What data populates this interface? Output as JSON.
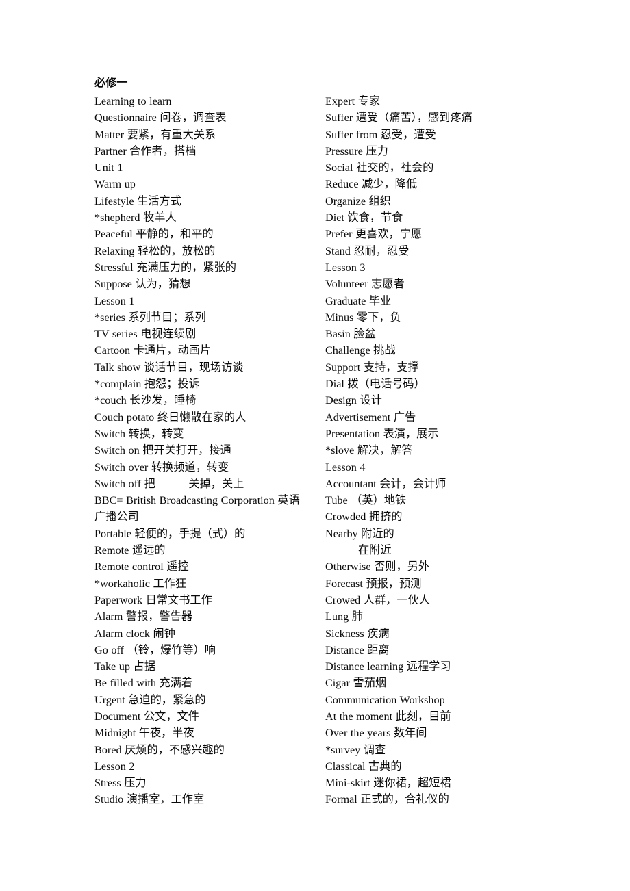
{
  "document": {
    "heading": "必修一"
  },
  "columns": {
    "left": [
      {
        "text": "Learning to learn"
      },
      {
        "text": "Questionnaire  问卷，调查表"
      },
      {
        "text": "Matter  要紧，有重大关系"
      },
      {
        "text": "Partner  合作者，搭档"
      },
      {
        "text": "Unit 1"
      },
      {
        "text": "Warm up"
      },
      {
        "text": "Lifestyle  生活方式"
      },
      {
        "text": "*shepherd  牧羊人"
      },
      {
        "text": "Peaceful  平静的，和平的"
      },
      {
        "text": "Relaxing  轻松的，放松的"
      },
      {
        "text": "Stressful  充满压力的，紧张的"
      },
      {
        "text": "Suppose  认为，猜想"
      },
      {
        "text": "Lesson 1"
      },
      {
        "text": "*series  系列节目；系列"
      },
      {
        "text": "TV series  电视连续剧"
      },
      {
        "text": "Cartoon  卡通片，动画片"
      },
      {
        "text": "Talk show  谈话节目，现场访谈"
      },
      {
        "text": "*complain  抱怨；投诉"
      },
      {
        "text": "*couch  长沙发，睡椅"
      },
      {
        "text": "Couch potato  终日懒散在家的人"
      },
      {
        "text": "Switch  转换，转变"
      },
      {
        "text": "Switch on  把开关打开，接通"
      },
      {
        "text": "Switch over  转换频道，转变"
      },
      {
        "text": "Switch off 把　　　关掉，关上"
      },
      {
        "text": "BBC= British Broadcasting Corporation  英语广播公司",
        "wrap": true
      },
      {
        "text": "Portable  轻便的，手提（式）的"
      },
      {
        "text": "Remote  遥远的"
      },
      {
        "text": "Remote control  遥控"
      },
      {
        "text": "*workaholic  工作狂"
      },
      {
        "text": "Paperwork  日常文书工作"
      },
      {
        "text": "Alarm  警报，警告器"
      },
      {
        "text": "Alarm clock  闹钟"
      },
      {
        "text": "Go off  （铃，爆竹等）响"
      },
      {
        "text": "Take up  占据"
      },
      {
        "text": "Be filled with  充满着"
      },
      {
        "text": "Urgent  急迫的，紧急的"
      },
      {
        "text": "Document  公文，文件"
      },
      {
        "text": "Midnight  午夜，半夜"
      },
      {
        "text": "Bored  厌烦的，不感兴趣的"
      },
      {
        "text": "Lesson 2"
      },
      {
        "text": "Stress  压力"
      },
      {
        "text": "Studio  演播室，工作室"
      }
    ],
    "right": [
      {
        "text": "Expert  专家"
      },
      {
        "text": "Suffer  遭受（痛苦），感到疼痛"
      },
      {
        "text": "Suffer from  忍受，遭受"
      },
      {
        "text": "Pressure  压力"
      },
      {
        "text": "Social  社交的，社会的"
      },
      {
        "text": "Reduce  减少，降低"
      },
      {
        "text": "Organize  组织"
      },
      {
        "text": "Diet  饮食，节食"
      },
      {
        "text": "Prefer  更喜欢，宁愿"
      },
      {
        "text": "Stand  忍耐，忍受"
      },
      {
        "text": "Lesson 3"
      },
      {
        "text": "Volunteer  志愿者"
      },
      {
        "text": "Graduate  毕业"
      },
      {
        "text": "Minus  零下，负"
      },
      {
        "text": "Basin  脸盆"
      },
      {
        "text": "Challenge  挑战"
      },
      {
        "text": "Support  支持，支撑"
      },
      {
        "text": "Dial  拨（电话号码）"
      },
      {
        "text": "Design  设计"
      },
      {
        "text": "Advertisement  广告"
      },
      {
        "text": "Presentation  表演，展示"
      },
      {
        "text": "*slove  解决，解答"
      },
      {
        "text": "Lesson 4"
      },
      {
        "text": "Accountant  会计，会计师"
      },
      {
        "text": "Tube  （英）地铁"
      },
      {
        "text": "Crowded  拥挤的"
      },
      {
        "text": "Nearby  附近的"
      },
      {
        "text": "在附近",
        "continuation": true
      },
      {
        "text": "Otherwise  否则，另外"
      },
      {
        "text": "Forecast  预报，预测"
      },
      {
        "text": "Crowed  人群，一伙人"
      },
      {
        "text": "Lung  肺"
      },
      {
        "text": "Sickness  疾病"
      },
      {
        "text": "Distance  距离"
      },
      {
        "text": "Distance learning  远程学习"
      },
      {
        "text": "Cigar  雪茄烟"
      },
      {
        "text": "Communication Workshop"
      },
      {
        "text": "At the moment  此刻，目前"
      },
      {
        "text": "Over the years  数年间"
      },
      {
        "text": "*survey  调查"
      },
      {
        "text": "Classical  古典的"
      },
      {
        "text": "Mini-skirt 迷你裙，超短裙"
      },
      {
        "text": "Formal  正式的，合礼仪的"
      }
    ]
  }
}
